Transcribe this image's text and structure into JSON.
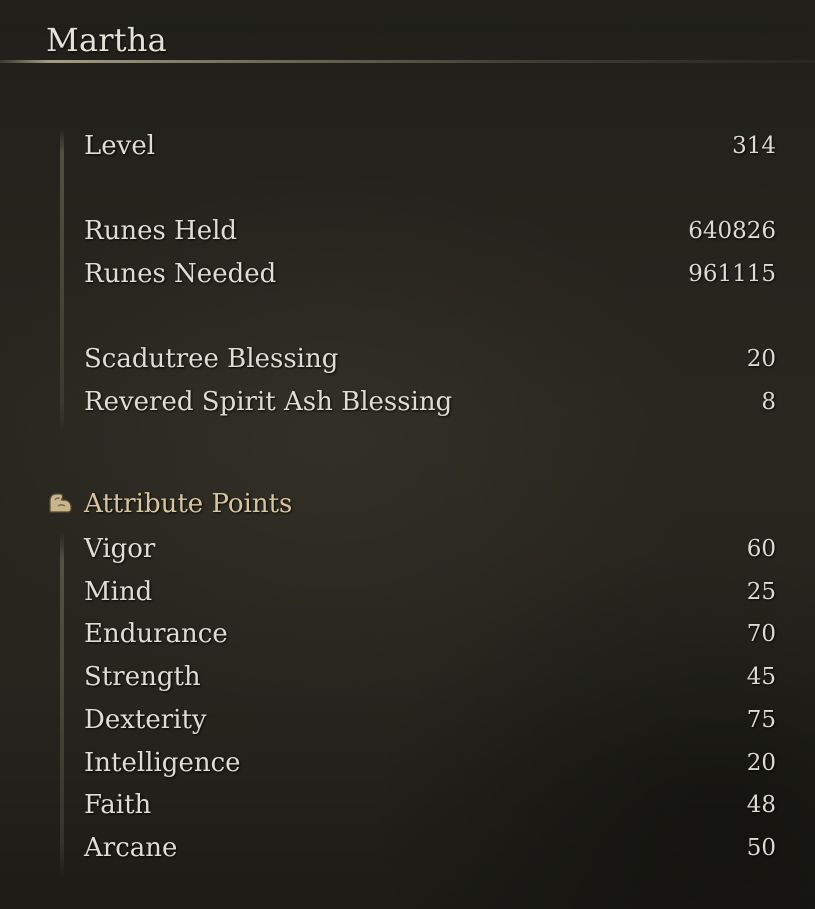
{
  "character": {
    "name": "Martha"
  },
  "stats": {
    "level": {
      "label": "Level",
      "value": "314"
    },
    "runes_held": {
      "label": "Runes Held",
      "value": "640826"
    },
    "runes_needed": {
      "label": "Runes Needed",
      "value": "961115"
    },
    "scadutree_blessing": {
      "label": "Scadutree Blessing",
      "value": "20"
    },
    "revered_spirit_ash_blessing": {
      "label": "Revered Spirit Ash Blessing",
      "value": "8"
    }
  },
  "attributes": {
    "header": "Attribute Points",
    "icon": "flexed-arm-icon",
    "accent_color": "#d8c59e",
    "items": [
      {
        "label": "Vigor",
        "value": "60"
      },
      {
        "label": "Mind",
        "value": "25"
      },
      {
        "label": "Endurance",
        "value": "70"
      },
      {
        "label": "Strength",
        "value": "45"
      },
      {
        "label": "Dexterity",
        "value": "75"
      },
      {
        "label": "Intelligence",
        "value": "20"
      },
      {
        "label": "Faith",
        "value": "48"
      },
      {
        "label": "Arcane",
        "value": "50"
      }
    ]
  }
}
